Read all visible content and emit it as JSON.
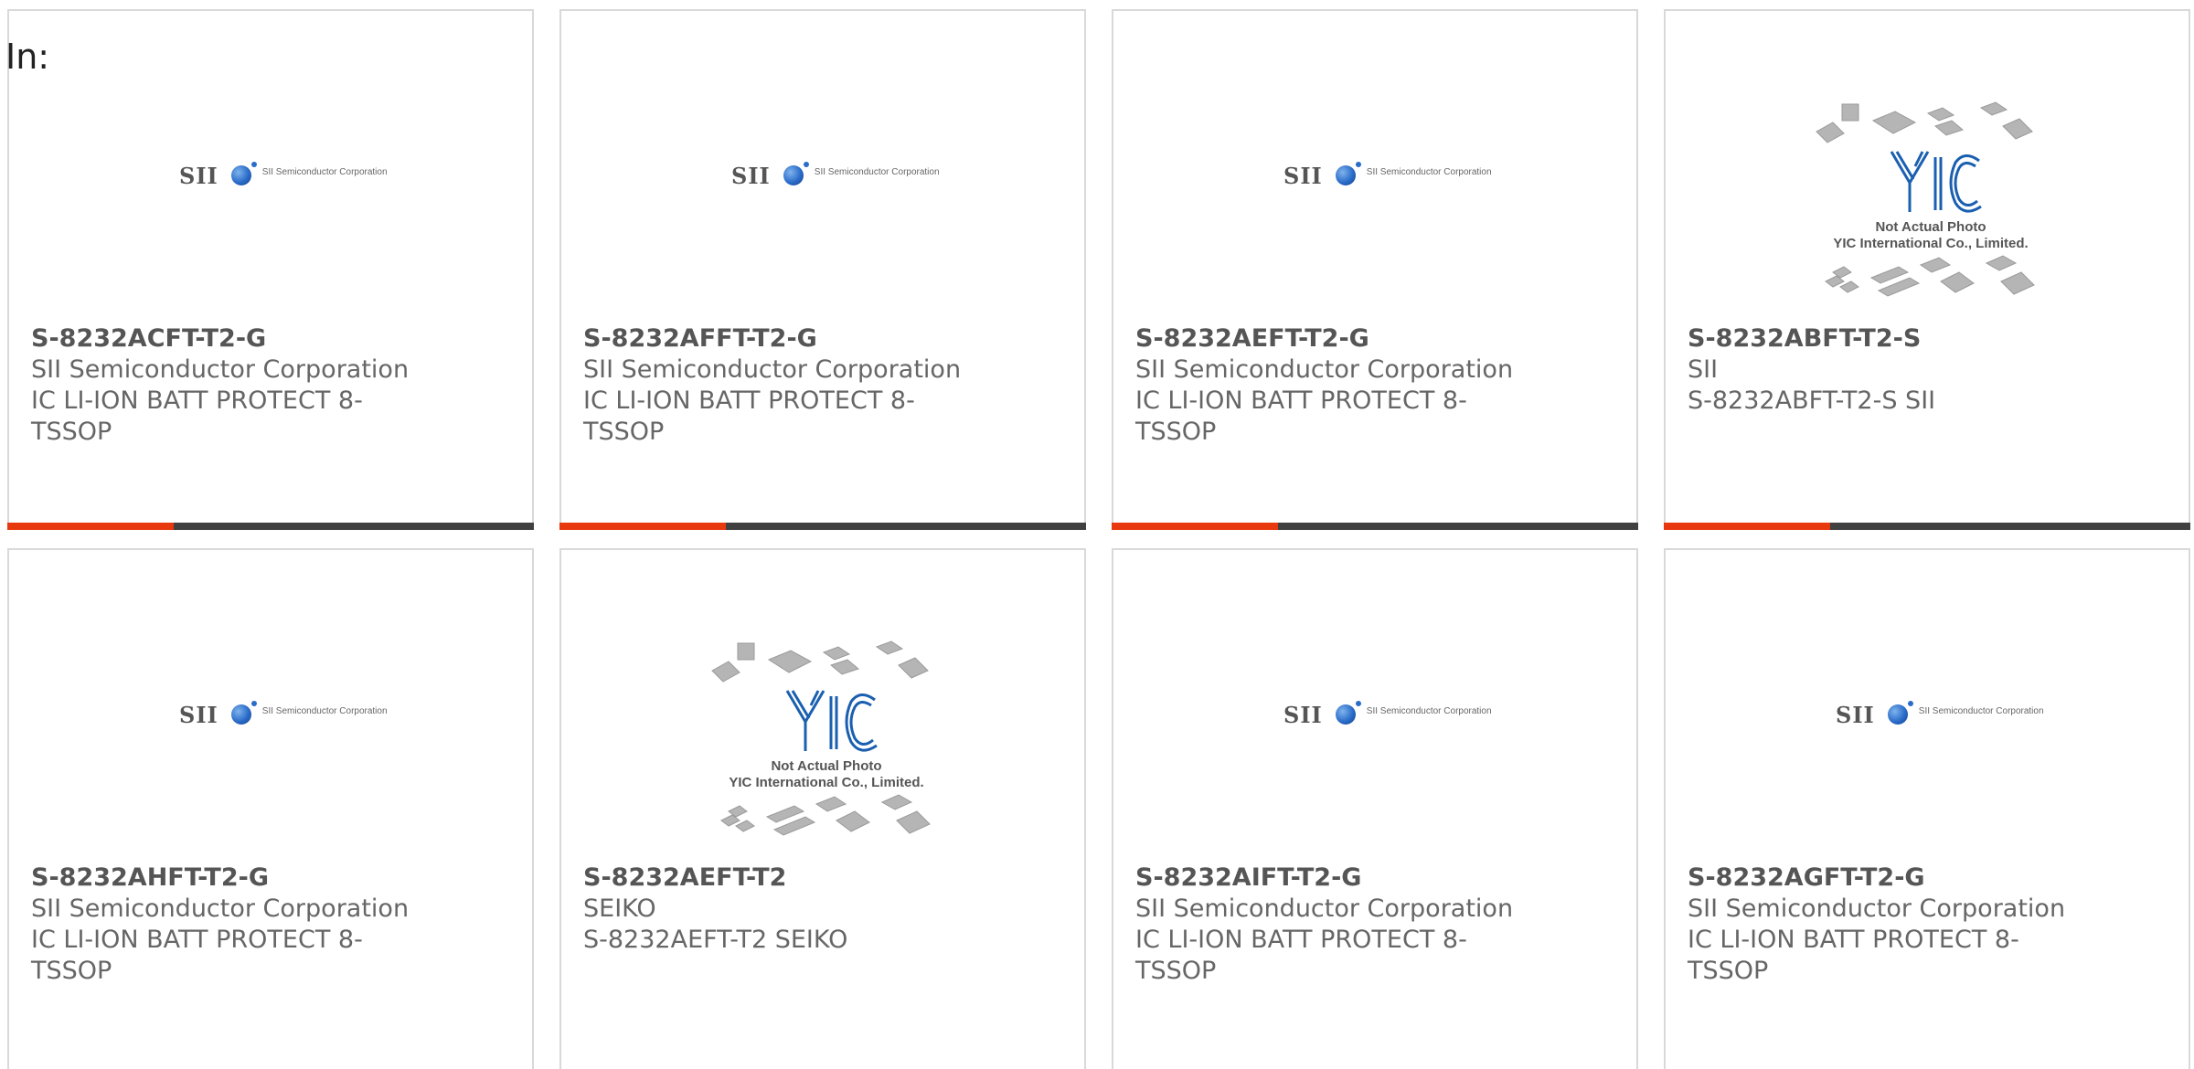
{
  "header": {
    "in_label": "In:"
  },
  "cards": [
    {
      "part_number": "S-8232ACFT-T2-G",
      "manufacturer": "SII Semiconductor Corporation",
      "description_line1": "IC LI-ION BATT PROTECT 8-",
      "description_line2": "TSSOP",
      "image": "sii-logo"
    },
    {
      "part_number": "S-8232AFFT-T2-G",
      "manufacturer": "SII Semiconductor Corporation",
      "description_line1": "IC LI-ION BATT PROTECT 8-",
      "description_line2": "TSSOP",
      "image": "sii-logo"
    },
    {
      "part_number": "S-8232AEFT-T2-G",
      "manufacturer": "SII Semiconductor Corporation",
      "description_line1": "IC LI-ION BATT PROTECT 8-",
      "description_line2": "TSSOP",
      "image": "sii-logo"
    },
    {
      "part_number": "S-8232ABFT-T2-S",
      "manufacturer": "SII",
      "description_line1": "S-8232ABFT-T2-S SII",
      "description_line2": "",
      "image": "yic-placeholder"
    },
    {
      "part_number": "S-8232AHFT-T2-G",
      "manufacturer": "SII Semiconductor Corporation",
      "description_line1": "IC LI-ION BATT PROTECT 8-",
      "description_line2": "TSSOP",
      "image": "sii-logo"
    },
    {
      "part_number": "S-8232AEFT-T2",
      "manufacturer": "SEIKO",
      "description_line1": "S-8232AEFT-T2 SEIKO",
      "description_line2": "",
      "image": "yic-placeholder"
    },
    {
      "part_number": "S-8232AIFT-T2-G",
      "manufacturer": "SII Semiconductor Corporation",
      "description_line1": "IC LI-ION BATT PROTECT 8-",
      "description_line2": "TSSOP",
      "image": "sii-logo"
    },
    {
      "part_number": "S-8232AGFT-T2-G",
      "manufacturer": "SII Semiconductor Corporation",
      "description_line1": "IC LI-ION BATT PROTECT 8-",
      "description_line2": "TSSOP",
      "image": "sii-logo"
    }
  ],
  "logos": {
    "sii_text": "SII",
    "sii_corp_text": "SII Semiconductor Corporation",
    "yic_caption_line1": "Not Actual Photo",
    "yic_caption_line2": "YIC International Co., Limited."
  },
  "colors": {
    "accent": "#e8380d",
    "bar": "#404040",
    "border": "#d9d9d9",
    "text": "#666666"
  }
}
